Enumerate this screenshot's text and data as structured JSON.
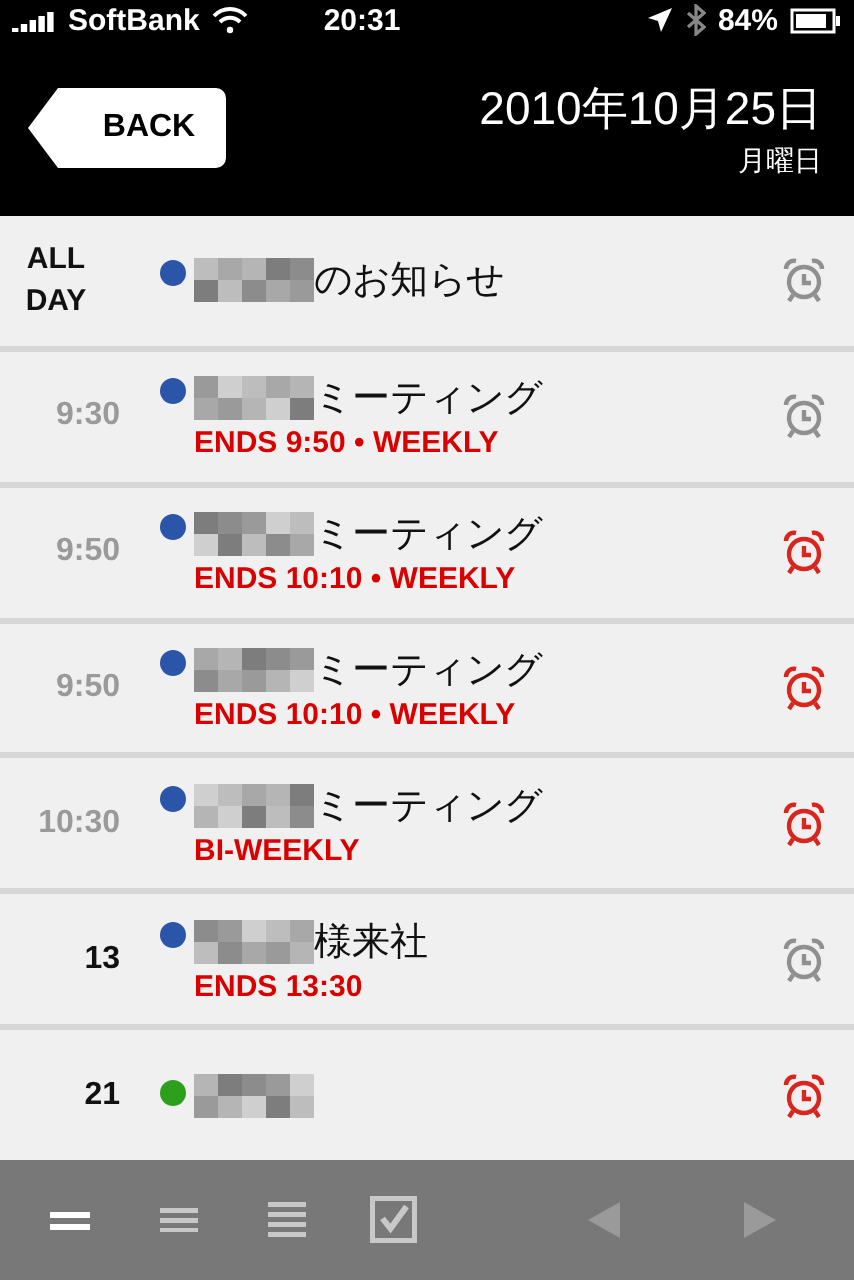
{
  "status_bar": {
    "carrier": "SoftBank",
    "time": "20:31",
    "battery": "84%"
  },
  "header": {
    "back": "BACK",
    "date": "2010年10月25日",
    "weekday": "月曜日"
  },
  "events": [
    {
      "time": "ALL DAY",
      "past": false,
      "color": "#2a55a8",
      "redacted": true,
      "title": "のお知らせ",
      "alarm_on": false
    },
    {
      "time": "9:30",
      "past": true,
      "color": "#2a55a8",
      "redacted": true,
      "title": "ミーティング",
      "detail": "ENDS 9:50 • WEEKLY",
      "alarm_on": false
    },
    {
      "time": "9:50",
      "past": true,
      "color": "#2a55a8",
      "redacted": true,
      "title": "ミーティング",
      "detail": "ENDS 10:10 • WEEKLY",
      "alarm_on": true
    },
    {
      "time": "9:50",
      "past": true,
      "color": "#2a55a8",
      "redacted": true,
      "title": "ミーティング",
      "detail": "ENDS 10:10 • WEEKLY",
      "alarm_on": true
    },
    {
      "time": "10:30",
      "past": true,
      "color": "#2a55a8",
      "redacted": true,
      "title": "ミーティング",
      "detail": "BI-WEEKLY",
      "alarm_on": true
    },
    {
      "time": "13",
      "past": false,
      "color": "#2a55a8",
      "redacted": true,
      "title": "様来社",
      "detail": "ENDS 13:30",
      "alarm_on": false
    },
    {
      "time": "21",
      "past": false,
      "color": "#2ca01c",
      "redacted": true,
      "alarm_on": true
    }
  ],
  "toolbar": {
    "views": [
      {
        "kind": "two-lines",
        "selected": true
      },
      {
        "kind": "three-lines",
        "selected": false
      },
      {
        "kind": "four-lines",
        "selected": false
      },
      {
        "kind": "checkbox",
        "selected": false
      }
    ],
    "prev_disabled": true,
    "next_disabled": true
  }
}
